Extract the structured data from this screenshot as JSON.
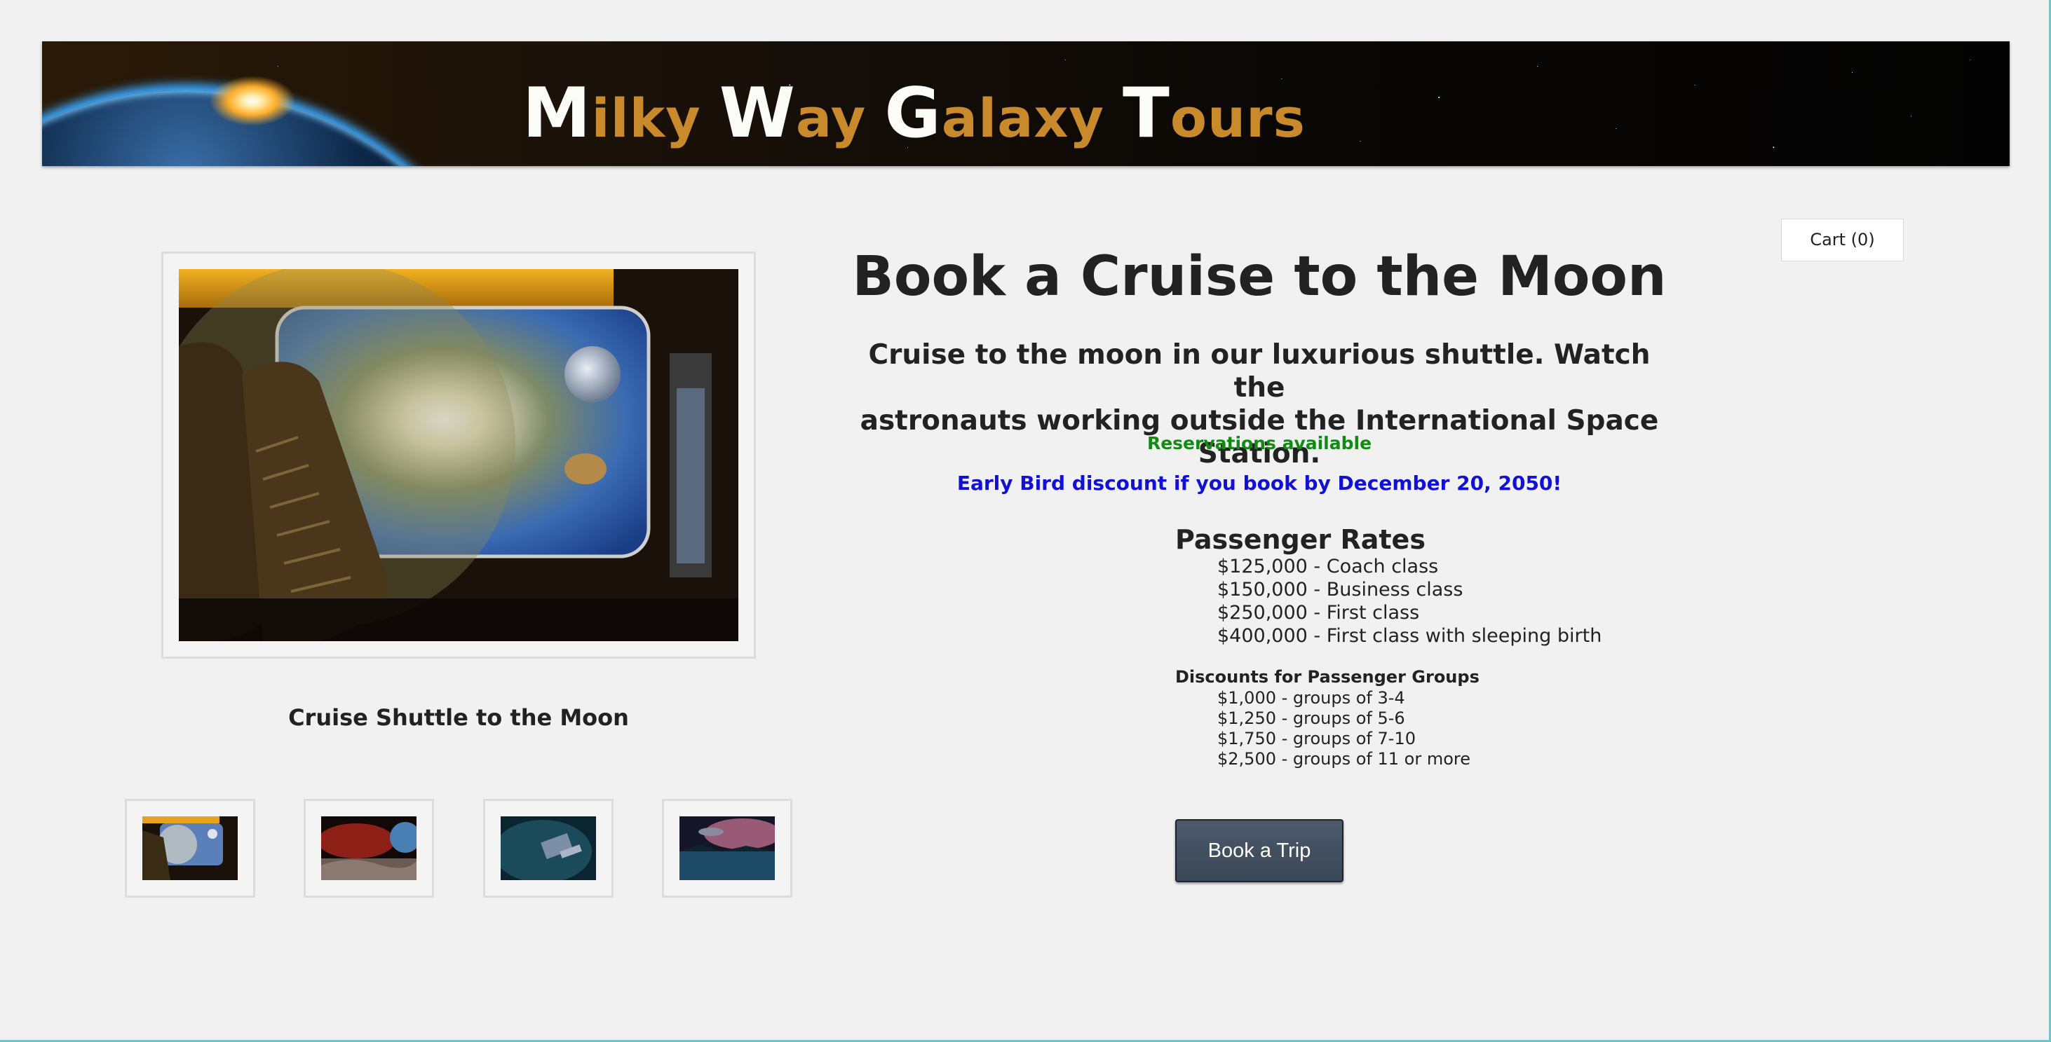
{
  "banner": {
    "title_words": [
      {
        "cap": "M",
        "rest": "ilky"
      },
      {
        "cap": "W",
        "rest": "ay"
      },
      {
        "cap": "G",
        "rest": "alaxy"
      },
      {
        "cap": "T",
        "rest": "ours"
      }
    ]
  },
  "cart": {
    "label": "Cart (0)"
  },
  "gallery": {
    "main_caption": "Cruise Shuttle to the Moon",
    "thumbnails": [
      "shuttle-interior",
      "red-planet-landscape",
      "space-station",
      "pink-nebula-lake"
    ]
  },
  "product": {
    "title": "Book a Cruise to the Moon",
    "description_line1": "Cruise to the moon in our luxurious shuttle. Watch the",
    "description_line2": "astronauts working outside the International Space Station.",
    "availability": "Reservations available",
    "promo": "Early Bird discount if you book by December 20, 2050!",
    "rates_heading": "Passenger Rates",
    "rates": [
      "$125,000 - Coach class",
      "$150,000 - Business class",
      "$250,000 - First class",
      "$400,000 - First class with sleeping birth"
    ],
    "discounts_heading": "Discounts for Passenger Groups",
    "discounts": [
      "$1,000 - groups of 3-4",
      "$1,250 - groups of 5-6",
      "$1,750 - groups of 7-10",
      "$2,500 - groups of 11 or more"
    ],
    "book_button": "Book a Trip"
  },
  "colors": {
    "availability": "#138a13",
    "promo": "#1010d6",
    "button": "#3f4b5a",
    "banner_accent": "#c98a2c"
  }
}
